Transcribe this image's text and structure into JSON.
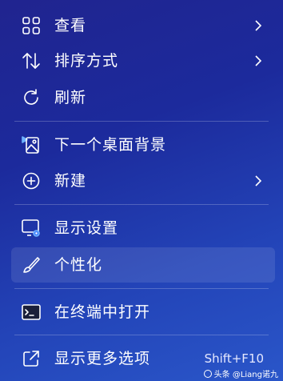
{
  "menu": {
    "items": [
      {
        "label": "查看",
        "icon": "grid-icon",
        "submenu": true
      },
      {
        "label": "排序方式",
        "icon": "sort-icon",
        "submenu": true
      },
      {
        "label": "刷新",
        "icon": "refresh-icon",
        "submenu": false
      },
      {
        "label": "下一个桌面背景",
        "icon": "next-background-icon",
        "submenu": false
      },
      {
        "label": "新建",
        "icon": "plus-circle-icon",
        "submenu": true
      },
      {
        "label": "显示设置",
        "icon": "display-settings-icon",
        "submenu": false
      },
      {
        "label": "个性化",
        "icon": "brush-icon",
        "submenu": false,
        "highlighted": true
      },
      {
        "label": "在终端中打开",
        "icon": "terminal-icon",
        "submenu": false
      },
      {
        "label": "显示更多选项",
        "icon": "external-link-icon",
        "submenu": false,
        "shortcut": "Shift+F10"
      }
    ]
  },
  "watermark": "头条 @Liang诺九",
  "colors": {
    "background_top": "#20248f",
    "background_bottom": "#2a56c9",
    "text": "#ffffff",
    "highlight": "rgba(255,255,255,0.10)"
  }
}
